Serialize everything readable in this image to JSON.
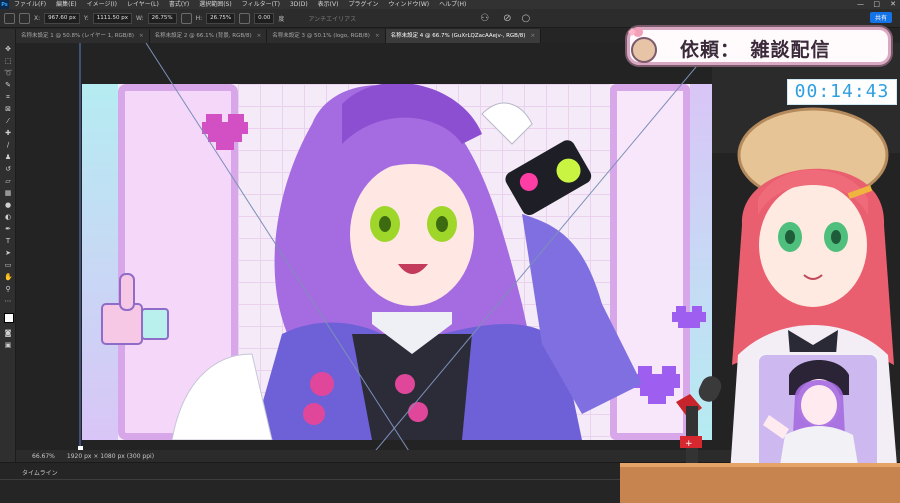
{
  "menubar": {
    "logo": "Ps",
    "items": [
      "ファイル(F)",
      "編集(E)",
      "イメージ(I)",
      "レイヤー(L)",
      "書式(Y)",
      "選択範囲(S)",
      "フィルター(T)",
      "3D(D)",
      "表示(V)",
      "プラグイン",
      "ウィンドウ(W)",
      "ヘルプ(H)"
    ],
    "window_controls": [
      "—",
      "□",
      "✕"
    ]
  },
  "options": {
    "x_label": "X:",
    "x_value": "967.60 px",
    "y_label": "Y:",
    "y_value": "1111.50 px",
    "w_label": "W:",
    "w_value": "26.75%",
    "h_label": "H:",
    "h_value": "26.75%",
    "angle_value": "0.00",
    "angle_unit": "度",
    "interp_label": "アンチエイリアス",
    "share_label": "共有"
  },
  "tabs": [
    {
      "label": "名称未設定 1 @ 50.8% (レイヤー 1, RGB/8)",
      "close": "×"
    },
    {
      "label": "名称未設定 2 @ 66.1% (背景, RGB/8)",
      "close": "×"
    },
    {
      "label": "名称未設定 3 @ 50.1% (logo, RGB/8)",
      "close": "×"
    },
    {
      "label": "名称未設定 4 @ 66.7% (GuXrLQZacAAejv-, RGB/8)",
      "close": "×",
      "active": true
    }
  ],
  "status": {
    "zoom": "66.67%",
    "doc_size": "1920 px × 1080 px (300 ppi)"
  },
  "timeline": {
    "label": "タイムライン"
  },
  "overlay": {
    "title": "依頼：　雑談配信",
    "timer": "00:14:43"
  },
  "colors": {
    "accent": "#1473e6",
    "timer_text": "#2f9fe0",
    "title_border": "#d9a9c4",
    "art_purple": "#a56be0"
  },
  "toolbar_icons": [
    "move-icon",
    "marquee-icon",
    "lasso-icon",
    "quick-select-icon",
    "crop-icon",
    "frame-icon",
    "eyedropper-icon",
    "healing-icon",
    "brush-icon",
    "stamp-icon",
    "history-brush-icon",
    "eraser-icon",
    "gradient-icon",
    "blur-icon",
    "dodge-icon",
    "pen-icon",
    "type-icon",
    "path-select-icon",
    "shape-icon",
    "hand-icon",
    "zoom-icon",
    "more-icon",
    "color-swatch-icon",
    "quick-mask-icon",
    "screen-mode-icon"
  ]
}
